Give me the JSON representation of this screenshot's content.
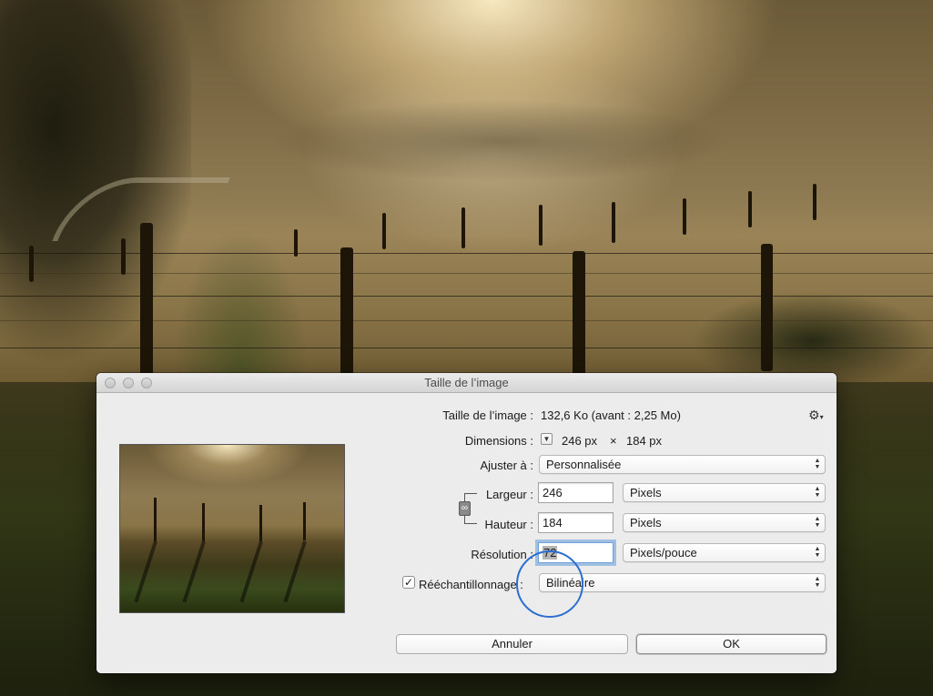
{
  "dialog": {
    "title": "Taille de l’image",
    "image_size_label": "Taille de l’image :",
    "image_size_value": "132,6 Ko (avant : 2,25 Mo)",
    "dimensions_label": "Dimensions :",
    "dimensions_width": "246 px",
    "dimensions_x": "×",
    "dimensions_height": "184 px",
    "fit_label": "Ajuster à :",
    "fit_value": "Personnalisée",
    "width_label": "Largeur :",
    "width_value": "246",
    "width_unit": "Pixels",
    "height_label": "Hauteur :",
    "height_value": "184",
    "height_unit": "Pixels",
    "resolution_label": "Résolution :",
    "resolution_value": "72",
    "resolution_unit": "Pixels/pouce",
    "resample_label": "Rééchantillonnage :",
    "resample_checked": true,
    "resample_value": "Bilinéaire",
    "cancel_label": "Annuler",
    "ok_label": "OK"
  },
  "icons": {
    "gear": "gear-icon",
    "link": "chain-link-icon",
    "disclosure": "triangle-down-icon",
    "popup_arrows": "up-down-arrows-icon",
    "checkmark": "checkmark-icon"
  },
  "colors": {
    "focus_ring": "#6fa0d8",
    "annotation_circle": "#2b6ed0",
    "dialog_bg": "#ececec"
  }
}
